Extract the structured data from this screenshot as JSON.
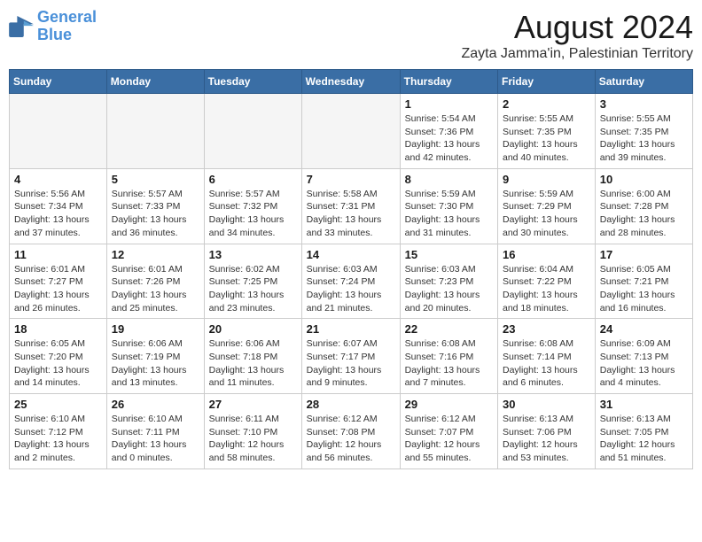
{
  "header": {
    "logo_general": "General",
    "logo_blue": "Blue",
    "main_title": "August 2024",
    "subtitle": "Zayta Jamma'in, Palestinian Territory"
  },
  "weekdays": [
    "Sunday",
    "Monday",
    "Tuesday",
    "Wednesday",
    "Thursday",
    "Friday",
    "Saturday"
  ],
  "weeks": [
    [
      {
        "day": "",
        "info": ""
      },
      {
        "day": "",
        "info": ""
      },
      {
        "day": "",
        "info": ""
      },
      {
        "day": "",
        "info": ""
      },
      {
        "day": "1",
        "info": "Sunrise: 5:54 AM\nSunset: 7:36 PM\nDaylight: 13 hours\nand 42 minutes."
      },
      {
        "day": "2",
        "info": "Sunrise: 5:55 AM\nSunset: 7:35 PM\nDaylight: 13 hours\nand 40 minutes."
      },
      {
        "day": "3",
        "info": "Sunrise: 5:55 AM\nSunset: 7:35 PM\nDaylight: 13 hours\nand 39 minutes."
      }
    ],
    [
      {
        "day": "4",
        "info": "Sunrise: 5:56 AM\nSunset: 7:34 PM\nDaylight: 13 hours\nand 37 minutes."
      },
      {
        "day": "5",
        "info": "Sunrise: 5:57 AM\nSunset: 7:33 PM\nDaylight: 13 hours\nand 36 minutes."
      },
      {
        "day": "6",
        "info": "Sunrise: 5:57 AM\nSunset: 7:32 PM\nDaylight: 13 hours\nand 34 minutes."
      },
      {
        "day": "7",
        "info": "Sunrise: 5:58 AM\nSunset: 7:31 PM\nDaylight: 13 hours\nand 33 minutes."
      },
      {
        "day": "8",
        "info": "Sunrise: 5:59 AM\nSunset: 7:30 PM\nDaylight: 13 hours\nand 31 minutes."
      },
      {
        "day": "9",
        "info": "Sunrise: 5:59 AM\nSunset: 7:29 PM\nDaylight: 13 hours\nand 30 minutes."
      },
      {
        "day": "10",
        "info": "Sunrise: 6:00 AM\nSunset: 7:28 PM\nDaylight: 13 hours\nand 28 minutes."
      }
    ],
    [
      {
        "day": "11",
        "info": "Sunrise: 6:01 AM\nSunset: 7:27 PM\nDaylight: 13 hours\nand 26 minutes."
      },
      {
        "day": "12",
        "info": "Sunrise: 6:01 AM\nSunset: 7:26 PM\nDaylight: 13 hours\nand 25 minutes."
      },
      {
        "day": "13",
        "info": "Sunrise: 6:02 AM\nSunset: 7:25 PM\nDaylight: 13 hours\nand 23 minutes."
      },
      {
        "day": "14",
        "info": "Sunrise: 6:03 AM\nSunset: 7:24 PM\nDaylight: 13 hours\nand 21 minutes."
      },
      {
        "day": "15",
        "info": "Sunrise: 6:03 AM\nSunset: 7:23 PM\nDaylight: 13 hours\nand 20 minutes."
      },
      {
        "day": "16",
        "info": "Sunrise: 6:04 AM\nSunset: 7:22 PM\nDaylight: 13 hours\nand 18 minutes."
      },
      {
        "day": "17",
        "info": "Sunrise: 6:05 AM\nSunset: 7:21 PM\nDaylight: 13 hours\nand 16 minutes."
      }
    ],
    [
      {
        "day": "18",
        "info": "Sunrise: 6:05 AM\nSunset: 7:20 PM\nDaylight: 13 hours\nand 14 minutes."
      },
      {
        "day": "19",
        "info": "Sunrise: 6:06 AM\nSunset: 7:19 PM\nDaylight: 13 hours\nand 13 minutes."
      },
      {
        "day": "20",
        "info": "Sunrise: 6:06 AM\nSunset: 7:18 PM\nDaylight: 13 hours\nand 11 minutes."
      },
      {
        "day": "21",
        "info": "Sunrise: 6:07 AM\nSunset: 7:17 PM\nDaylight: 13 hours\nand 9 minutes."
      },
      {
        "day": "22",
        "info": "Sunrise: 6:08 AM\nSunset: 7:16 PM\nDaylight: 13 hours\nand 7 minutes."
      },
      {
        "day": "23",
        "info": "Sunrise: 6:08 AM\nSunset: 7:14 PM\nDaylight: 13 hours\nand 6 minutes."
      },
      {
        "day": "24",
        "info": "Sunrise: 6:09 AM\nSunset: 7:13 PM\nDaylight: 13 hours\nand 4 minutes."
      }
    ],
    [
      {
        "day": "25",
        "info": "Sunrise: 6:10 AM\nSunset: 7:12 PM\nDaylight: 13 hours\nand 2 minutes."
      },
      {
        "day": "26",
        "info": "Sunrise: 6:10 AM\nSunset: 7:11 PM\nDaylight: 13 hours\nand 0 minutes."
      },
      {
        "day": "27",
        "info": "Sunrise: 6:11 AM\nSunset: 7:10 PM\nDaylight: 12 hours\nand 58 minutes."
      },
      {
        "day": "28",
        "info": "Sunrise: 6:12 AM\nSunset: 7:08 PM\nDaylight: 12 hours\nand 56 minutes."
      },
      {
        "day": "29",
        "info": "Sunrise: 6:12 AM\nSunset: 7:07 PM\nDaylight: 12 hours\nand 55 minutes."
      },
      {
        "day": "30",
        "info": "Sunrise: 6:13 AM\nSunset: 7:06 PM\nDaylight: 12 hours\nand 53 minutes."
      },
      {
        "day": "31",
        "info": "Sunrise: 6:13 AM\nSunset: 7:05 PM\nDaylight: 12 hours\nand 51 minutes."
      }
    ]
  ]
}
